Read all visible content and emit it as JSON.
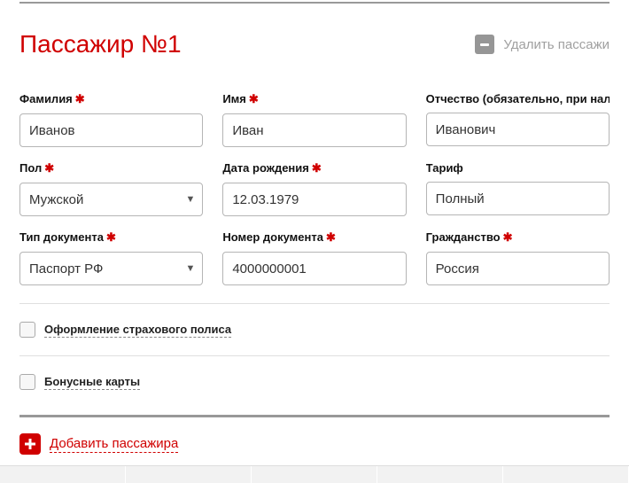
{
  "header": {
    "title": "Пассажир №1",
    "remove_label": "Удалить пассажи"
  },
  "fields": {
    "surname": {
      "label": "Фамилия",
      "value": "Иванов",
      "required": true
    },
    "name": {
      "label": "Имя",
      "value": "Иван",
      "required": true
    },
    "patronymic": {
      "label": "Отчество (обязательно, при наличии)",
      "value": "Иванович",
      "required": true
    },
    "gender": {
      "label": "Пол",
      "value": "Мужской",
      "required": true
    },
    "dob": {
      "label": "Дата рождения",
      "value": "12.03.1979",
      "required": true
    },
    "tariff": {
      "label": "Тариф",
      "value": "Полный",
      "required": false
    },
    "doc_type": {
      "label": "Тип документа",
      "value": "Паспорт РФ",
      "required": true
    },
    "doc_num": {
      "label": "Номер документа",
      "value": "4000000001",
      "required": true
    },
    "citizen": {
      "label": "Гражданство",
      "value": "Россия",
      "required": true
    }
  },
  "checkboxes": {
    "insurance": "Оформление страхового полиса",
    "bonus": "Бонусные карты"
  },
  "footer": {
    "add_label": "Добавить пассажира"
  }
}
